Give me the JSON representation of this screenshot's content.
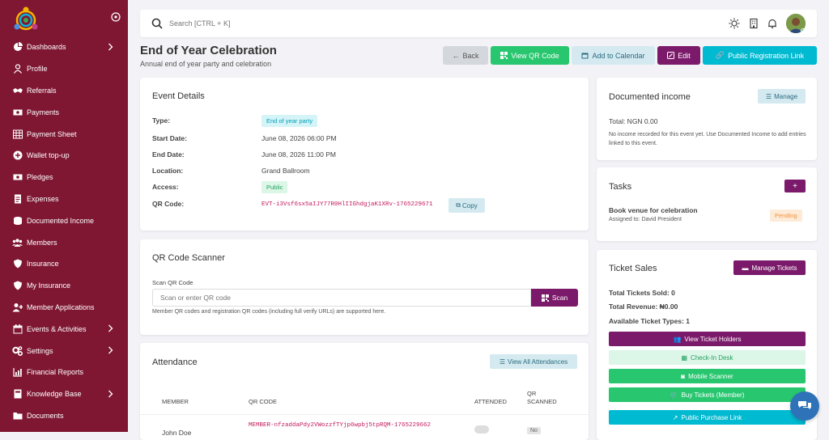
{
  "sidebar": {
    "items": [
      {
        "label": "Dashboards",
        "icon": "dashboard-icon",
        "chevron": true
      },
      {
        "label": "Profile",
        "icon": "user-icon",
        "chevron": false
      },
      {
        "label": "Referrals",
        "icon": "handshake-icon",
        "chevron": false
      },
      {
        "label": "Payments",
        "icon": "money-icon",
        "chevron": false
      },
      {
        "label": "Payment Sheet",
        "icon": "table-icon",
        "chevron": false
      },
      {
        "label": "Wallet top-up",
        "icon": "plus-circle-icon",
        "chevron": false
      },
      {
        "label": "Pledges",
        "icon": "money-icon",
        "chevron": false
      },
      {
        "label": "Expenses",
        "icon": "document-icon",
        "chevron": false
      },
      {
        "label": "Documented Income",
        "icon": "coins-icon",
        "chevron": false
      },
      {
        "label": "Members",
        "icon": "users-icon",
        "chevron": false
      },
      {
        "label": "Insurance",
        "icon": "shield-icon",
        "chevron": false
      },
      {
        "label": "My Insurance",
        "icon": "shield-icon",
        "chevron": false
      },
      {
        "label": "Member Applications",
        "icon": "user-plus-icon",
        "chevron": false
      },
      {
        "label": "Events & Activities",
        "icon": "calendar-icon",
        "chevron": true
      },
      {
        "label": "Settings",
        "icon": "gears-icon",
        "chevron": true
      },
      {
        "label": "Financial Reports",
        "icon": "chart-icon",
        "chevron": false
      },
      {
        "label": "Knowledge Base",
        "icon": "book-icon",
        "chevron": true
      },
      {
        "label": "Documents",
        "icon": "folder-icon",
        "chevron": false
      }
    ]
  },
  "search": {
    "placeholder": "Search [CTRL + K]"
  },
  "page": {
    "title": "End of Year Celebration",
    "subtitle": "Annual end of year party and celebration"
  },
  "actions": {
    "back": "Back",
    "view_qr": "View QR Code",
    "add_calendar": "Add to Calendar",
    "edit": "Edit",
    "public_link": "Public Registration Link"
  },
  "event_details": {
    "title": "Event Details",
    "type_label": "Type:",
    "type_value": "End of year party",
    "start_label": "Start Date:",
    "start_value": "June 08, 2026 06:00 PM",
    "end_label": "End Date:",
    "end_value": "June 08, 2026 11:00 PM",
    "location_label": "Location:",
    "location_value": "Grand Ballroom",
    "access_label": "Access:",
    "access_value": "Public",
    "qr_label": "QR Code:",
    "qr_value": "EVT-i3Vsf6sx5aIJY77R0HlIIGhdgjaK1XRv-1765229671",
    "copy": "Copy"
  },
  "scanner": {
    "title": "QR Code Scanner",
    "field_label": "Scan QR Code",
    "placeholder": "Scan or enter QR code",
    "scan": "Scan",
    "help": "Member QR codes and registration QR codes (including full verify URLs) are supported here."
  },
  "attendance": {
    "title": "Attendance",
    "view_all": "View All Attendances",
    "columns": [
      "MEMBER",
      "QR CODE",
      "ATTENDED",
      "QR SCANNED"
    ],
    "rows": [
      {
        "member": "John Doe",
        "qr": "MEMBER-nfzaddaPdy2VWozzfTYjp6wpbj5tpRQM-1765229662",
        "scanned": "No"
      }
    ]
  },
  "income": {
    "title": "Documented income",
    "manage": "Manage",
    "total": "Total: NGN 0.00",
    "note": "No income recorded for this event yet. Use Documented Income to add entries linked to this event."
  },
  "tasks": {
    "title": "Tasks",
    "add": "+",
    "task_title": "Book venue for celebration",
    "task_assigned": "Assigned to: David President",
    "task_status": "Pending"
  },
  "tickets": {
    "title": "Ticket Sales",
    "manage": "Manage Tickets",
    "sold": "Total Tickets Sold: 0",
    "revenue": "Total Revenue: ₦0.00",
    "types": "Available Ticket Types: 1",
    "holders": "View Ticket Holders",
    "checkin": "Check-In Desk",
    "mobile": "Mobile Scanner",
    "buy": "Buy Tickets (Member)",
    "public": "Public Purchase Link"
  },
  "colors": {
    "brand": "#7f1733",
    "accent": "#7b1a6a",
    "green": "#28c76f",
    "cyan": "#00bad1"
  }
}
